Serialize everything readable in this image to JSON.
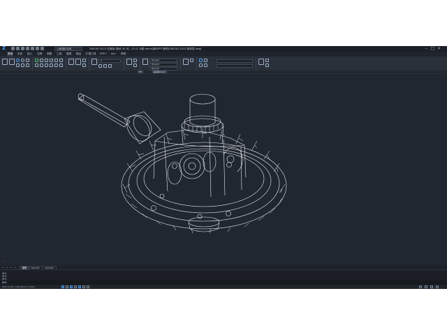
{
  "window": {
    "title": "ZWCAD 2022 试用版 (剩余 30 天) - [F:\\3. 功能 demo\\演示PPT\\素材\\ZWCAD 2022 新特性.dwg]",
    "minimize_icon": "minimize-icon",
    "maximize_icon": "maximize-icon",
    "close_icon": "close-icon"
  },
  "quick_access": {
    "workspace": "二维草图与注释"
  },
  "menu_tabs": [
    "常用",
    "实体",
    "插入",
    "注释",
    "视图",
    "工具",
    "管理",
    "输出",
    "扩展工具",
    "APP+",
    "Aec",
    "帮助"
  ],
  "active_menu_tab": 0,
  "ribbon": {
    "group_labels": [
      "绘图",
      "修改",
      "注释",
      "图层",
      "块",
      "特性",
      "组",
      "实用工具",
      "剪贴板"
    ],
    "layer_name": "0",
    "color_value": "ByLayer",
    "linetype_value": "ByLayer",
    "lineweight_value": "ByLayer"
  },
  "doc_tabs": {
    "start_tab": "开始",
    "drawing_tab": "差速器.dwg*"
  },
  "layout_tabs": [
    "模型",
    "Layout1",
    "Layout2"
  ],
  "active_layout_tab": 0,
  "command": {
    "history": [
      "命令:",
      "命令:",
      "命令:"
    ],
    "prompt": "命令:"
  },
  "status": {
    "coordinates": "2615.6718, 1289.6632, 0.0000"
  },
  "colors": {
    "background": "#212730",
    "wireframe": "#e8edf2",
    "accent": "#4aa3ff"
  }
}
